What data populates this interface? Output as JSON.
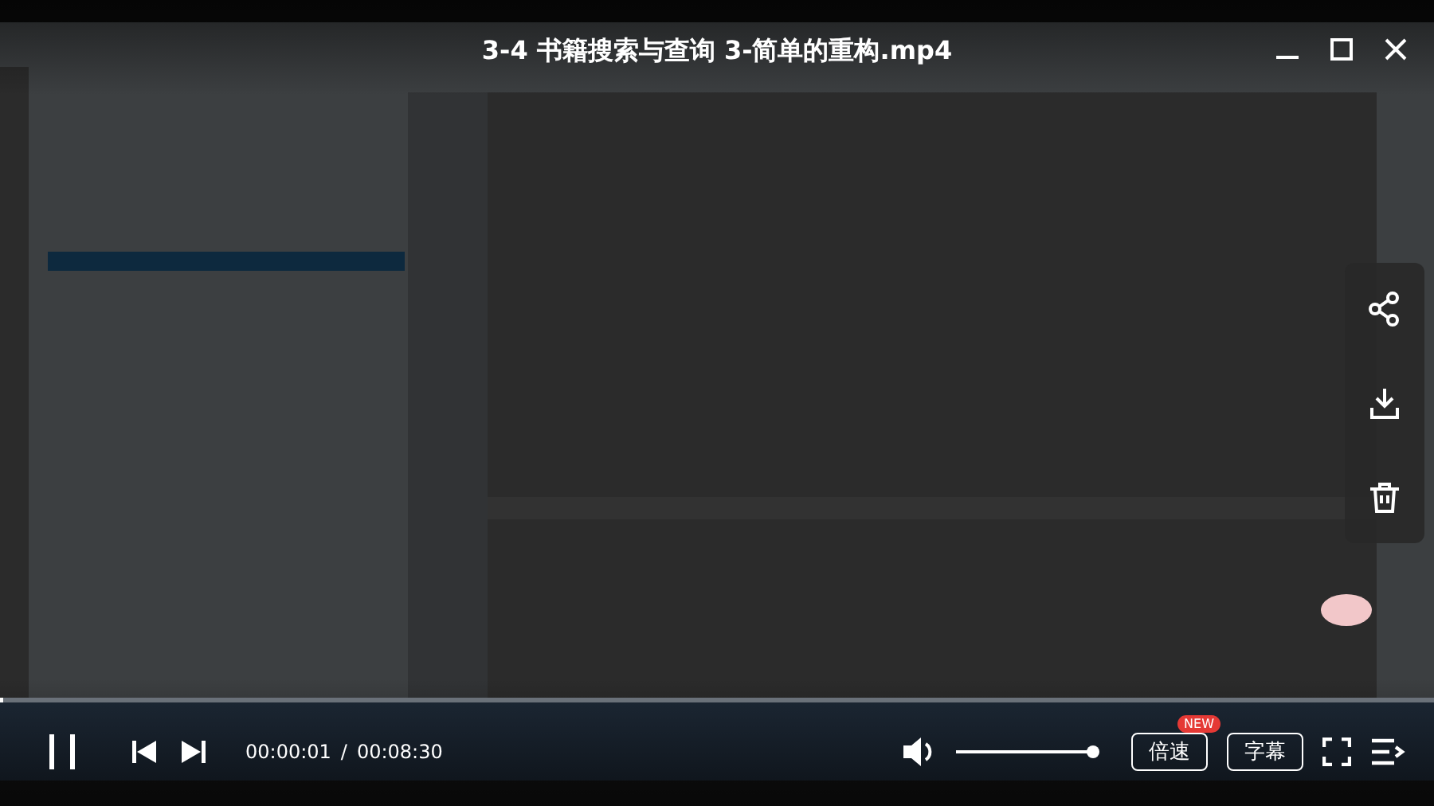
{
  "video": {
    "kind": "picture",
    "title": "3-4 书籍搜索与查询 3-简单的重构.mp4"
  },
  "side_actions": [
    {
      "kind": "share"
    },
    {
      "kind": "download"
    },
    {
      "kind": "delete"
    }
  ],
  "progress": {
    "level": 0.002
  },
  "controls": {
    "current_time": "00:00:01",
    "separator": "/",
    "duration": "00:08:30",
    "volume": {
      "level": 1
    },
    "speed_button": "倍速",
    "speed_badge": "NEW",
    "subtitle_button": "字幕"
  }
}
